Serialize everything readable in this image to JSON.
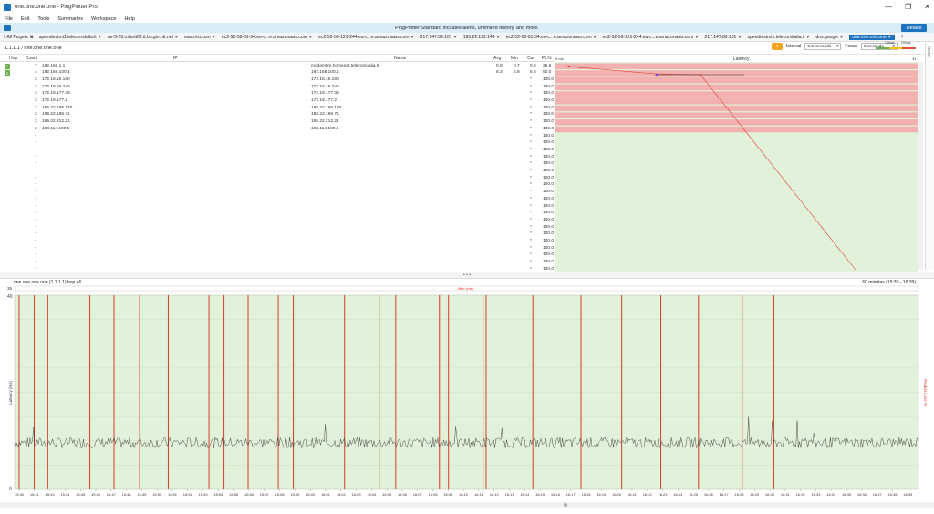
{
  "window": {
    "title": "one.one.one.one - PingPlotter Pro",
    "controls": [
      "—",
      "❐",
      "✕"
    ]
  },
  "menu": [
    "File",
    "Edit",
    "Tools",
    "Summaries",
    "Workspace",
    "Help"
  ],
  "promo": {
    "text": "PingPlotter Standard includes alerts, unlimited history, and more.",
    "button": "Details"
  },
  "tabs": {
    "all_label": "All Targets",
    "items": [
      "speedtestmi1.telecomitalia.it",
      "ae-3-20.mlantt02.it.bb.gin.ntt.net",
      "easo.eu.com",
      "ec2-52-58-81-34.eu-c...e.amazonaws.com",
      "ec2-52-59-121-244.eu-c...e.amazonaws.com",
      "217.147.89.101",
      "195.22.192.144",
      "ec2-52-58-81-34.eu-c...e.amazonaws.com",
      "ec2-52-59-121-244.eu-c...e.amazonaws.com",
      "217.147.89.101",
      "speedtestmi1.telecomitalia.it",
      "dns.google",
      "one.one.one.one"
    ],
    "active_index": 12,
    "add": "+"
  },
  "breadcrumb": "1.1.1.1 / one.one.one.one",
  "controls": {
    "interval_label": "Interval",
    "interval_value": "0.5 seconds",
    "focus_label": "Focus",
    "focus_value": "5 seconds"
  },
  "legend": {
    "low": "100ms",
    "high": "200ms"
  },
  "side_tab": "Alerts",
  "table": {
    "headers": {
      "hop": "Hop",
      "count": "Count",
      "ip": "IP",
      "name": "Name",
      "avg": "Avg",
      "min": "Min",
      "cur": "Cur",
      "pl": "PL%",
      "latency": "Latency",
      "scale0": "0 ms",
      "scale_end": "31"
    },
    "rows": [
      {
        "hop": "1",
        "count": "7",
        "ip": "192.168.1.1",
        "name": "modemtim.homenet.telecomitalia.it",
        "avg": "0.9",
        "min": "0.7",
        "cur": "0.8",
        "pl": "28.6"
      },
      {
        "hop": "2",
        "count": "4",
        "ip": "192.168.100.1",
        "name": "192.168.100.1",
        "avg": "8.3",
        "min": "5.8",
        "cur": "5.8",
        "pl": "50.0"
      },
      {
        "hop": "",
        "count": "2",
        "ip": "172.18.16.180",
        "name": "172.18.16.180",
        "avg": "",
        "min": "",
        "cur": "*",
        "pl": "100.0"
      },
      {
        "hop": "",
        "count": "2",
        "ip": "172.18.16.240",
        "name": "172.18.16.240",
        "avg": "",
        "min": "",
        "cur": "*",
        "pl": "100.0"
      },
      {
        "hop": "",
        "count": "2",
        "ip": "172.19.177.38",
        "name": "172.19.177.38",
        "avg": "",
        "min": "",
        "cur": "*",
        "pl": "100.0"
      },
      {
        "hop": "",
        "count": "2",
        "ip": "172.19.177.2",
        "name": "172.19.177.2",
        "avg": "",
        "min": "",
        "cur": "*",
        "pl": "100.0"
      },
      {
        "hop": "",
        "count": "2",
        "ip": "195.22.196.170",
        "name": "195.22.196.170",
        "avg": "",
        "min": "",
        "cur": "*",
        "pl": "100.0"
      },
      {
        "hop": "",
        "count": "2",
        "ip": "195.22.196.71",
        "name": "195.22.196.71",
        "avg": "",
        "min": "",
        "cur": "*",
        "pl": "100.0"
      },
      {
        "hop": "",
        "count": "2",
        "ip": "195.22.212.21",
        "name": "195.22.212.21",
        "avg": "",
        "min": "",
        "cur": "*",
        "pl": "100.0"
      },
      {
        "hop": "",
        "count": "2",
        "ip": "188.114.100.5",
        "name": "188.114.100.5",
        "avg": "",
        "min": "",
        "cur": "*",
        "pl": "100.0"
      },
      {
        "hop": "",
        "count": "-",
        "ip": "",
        "name": "",
        "avg": "",
        "min": "",
        "cur": "*",
        "pl": "100.0"
      },
      {
        "hop": "",
        "count": "-",
        "ip": "",
        "name": "",
        "avg": "",
        "min": "",
        "cur": "*",
        "pl": "100.0"
      },
      {
        "hop": "",
        "count": "-",
        "ip": "",
        "name": "",
        "avg": "",
        "min": "",
        "cur": "*",
        "pl": "100.0"
      },
      {
        "hop": "",
        "count": "-",
        "ip": "",
        "name": "",
        "avg": "",
        "min": "",
        "cur": "*",
        "pl": "100.0"
      },
      {
        "hop": "",
        "count": "-",
        "ip": "",
        "name": "",
        "avg": "",
        "min": "",
        "cur": "*",
        "pl": "100.0"
      },
      {
        "hop": "",
        "count": "-",
        "ip": "",
        "name": "",
        "avg": "",
        "min": "",
        "cur": "*",
        "pl": "100.0"
      },
      {
        "hop": "",
        "count": "-",
        "ip": "",
        "name": "",
        "avg": "",
        "min": "",
        "cur": "*",
        "pl": "100.0"
      },
      {
        "hop": "",
        "count": "-",
        "ip": "",
        "name": "",
        "avg": "",
        "min": "",
        "cur": "*",
        "pl": "100.0"
      },
      {
        "hop": "",
        "count": "-",
        "ip": "",
        "name": "",
        "avg": "",
        "min": "",
        "cur": "*",
        "pl": "100.0"
      },
      {
        "hop": "",
        "count": "-",
        "ip": "",
        "name": "",
        "avg": "",
        "min": "",
        "cur": "*",
        "pl": "100.0"
      },
      {
        "hop": "",
        "count": "-",
        "ip": "",
        "name": "",
        "avg": "",
        "min": "",
        "cur": "*",
        "pl": "100.0"
      },
      {
        "hop": "",
        "count": "-",
        "ip": "",
        "name": "",
        "avg": "",
        "min": "",
        "cur": "*",
        "pl": "100.0"
      },
      {
        "hop": "",
        "count": "-",
        "ip": "",
        "name": "",
        "avg": "",
        "min": "",
        "cur": "*",
        "pl": "100.0"
      },
      {
        "hop": "",
        "count": "-",
        "ip": "",
        "name": "",
        "avg": "",
        "min": "",
        "cur": "*",
        "pl": "100.0"
      },
      {
        "hop": "",
        "count": "-",
        "ip": "",
        "name": "",
        "avg": "",
        "min": "",
        "cur": "*",
        "pl": "100.0"
      },
      {
        "hop": "",
        "count": "-",
        "ip": "",
        "name": "",
        "avg": "",
        "min": "",
        "cur": "*",
        "pl": "100.0"
      },
      {
        "hop": "",
        "count": "-",
        "ip": "",
        "name": "",
        "avg": "",
        "min": "",
        "cur": "*",
        "pl": "100.0"
      },
      {
        "hop": "",
        "count": "-",
        "ip": "",
        "name": "",
        "avg": "",
        "min": "",
        "cur": "*",
        "pl": "100.0"
      },
      {
        "hop": "",
        "count": "-",
        "ip": "",
        "name": "",
        "avg": "",
        "min": "",
        "cur": "*",
        "pl": "100.0"
      },
      {
        "hop": "",
        "count": "-",
        "ip": "",
        "name": "",
        "avg": "",
        "min": "",
        "cur": "*",
        "pl": "100.0"
      }
    ]
  },
  "timeline": {
    "title": "one.one.one.one (1.1.1.1) hop 46",
    "range": "60 minutes (15:39 - 16:39)",
    "jitter_label": "Jitter (ms)",
    "y_top_label": "35",
    "y_max": "40",
    "y_min": "0",
    "y_axis_label": "Latency (ms)",
    "right_axis_label": "Packet Loss %",
    "x_ticks": [
      "15:40",
      "15:41",
      "15:43",
      "15:44",
      "15:45",
      "15:46",
      "15:47",
      "15:48",
      "15:49",
      "15:50",
      "15:51",
      "15:52",
      "15:53",
      "15:54",
      "15:55",
      "15:56",
      "15:57",
      "15:58",
      "15:59",
      "16:00",
      "16:01",
      "16:02",
      "16:03",
      "16:04",
      "16:05",
      "16:06",
      "16:07",
      "16:08",
      "16:09",
      "16:10",
      "16:11",
      "16:12",
      "16:13",
      "16:14",
      "16:15",
      "16:16",
      "16:17",
      "16:18",
      "16:19",
      "16:20",
      "16:21",
      "16:22",
      "16:23",
      "16:24",
      "16:25",
      "16:26",
      "16:27",
      "16:28",
      "16:29",
      "16:30",
      "16:31",
      "16:32",
      "16:33",
      "16:34",
      "16:35",
      "16:36",
      "16:37",
      "16:38",
      "16:39"
    ],
    "loss_events": [
      0.3,
      1.3,
      2.2,
      5.0,
      6.6,
      8.3,
      10.2,
      12.9,
      13.9,
      15.5,
      17.5,
      18.5,
      21.9,
      24.2,
      25.3,
      28.2,
      28.8,
      31.1,
      31.3,
      34.4,
      37.6,
      40.3,
      42.9,
      45.4,
      48.3,
      50.4
    ],
    "colors": {
      "bg_good": "#e2f1d9",
      "loss": "#d93a2a",
      "line": "#222222",
      "bad_row": "#f3b0b0"
    }
  }
}
